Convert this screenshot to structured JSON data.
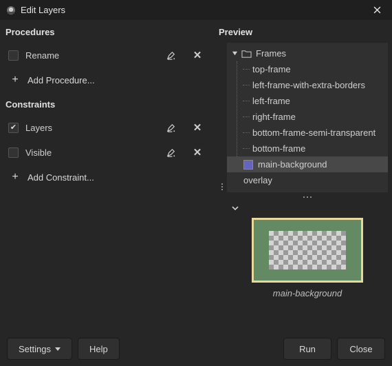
{
  "window": {
    "title": "Edit Layers"
  },
  "procedures": {
    "title": "Procedures",
    "items": [
      {
        "label": "Rename",
        "checked": false
      }
    ],
    "add": "Add Procedure..."
  },
  "constraints": {
    "title": "Constraints",
    "items": [
      {
        "label": "Layers",
        "checked": true
      },
      {
        "label": "Visible",
        "checked": false
      }
    ],
    "add": "Add Constraint..."
  },
  "preview": {
    "title": "Preview",
    "tree": {
      "root": "Frames",
      "children": [
        "top-frame",
        "left-frame-with-extra-borders",
        "left-frame",
        "right-frame",
        "bottom-frame-semi-transparent",
        "bottom-frame"
      ],
      "selected": "main-background",
      "after": "overlay"
    },
    "thumb_caption": "main-background"
  },
  "buttons": {
    "settings": "Settings",
    "help": "Help",
    "run": "Run",
    "close": "Close"
  }
}
